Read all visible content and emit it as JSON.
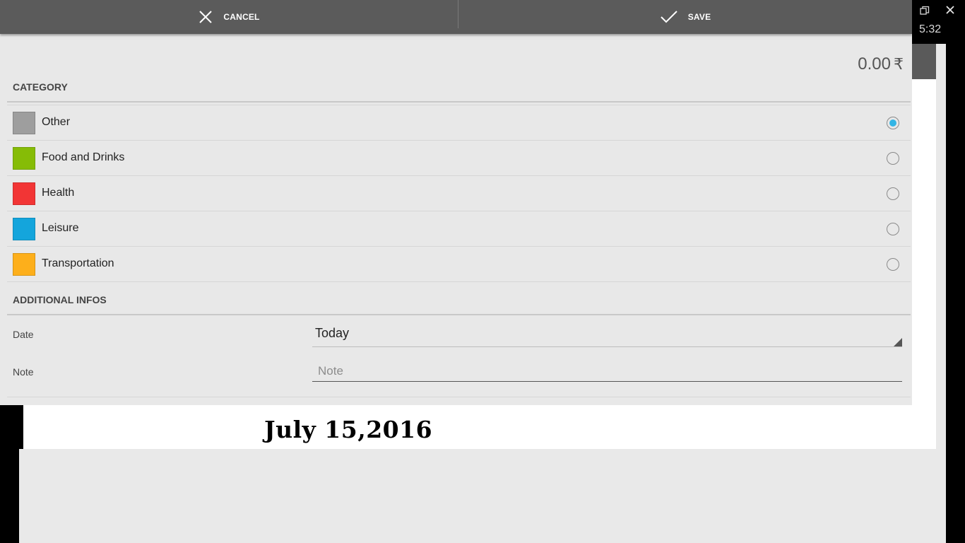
{
  "action_bar": {
    "cancel_label": "CANCEL",
    "cancel_icon": "close-icon",
    "save_label": "SAVE",
    "save_icon": "check-icon"
  },
  "amount": {
    "value": "0.00",
    "currency": "₹"
  },
  "category": {
    "header": "CATEGORY",
    "items": [
      {
        "label": "Other",
        "color": "#9e9e9e",
        "selected": true
      },
      {
        "label": "Food and Drinks",
        "color": "#86bc06",
        "selected": false
      },
      {
        "label": "Health",
        "color": "#f23535",
        "selected": false
      },
      {
        "label": "Leisure",
        "color": "#14a5dc",
        "selected": false
      },
      {
        "label": "Transportation",
        "color": "#fdaf1b",
        "selected": false
      }
    ]
  },
  "additional": {
    "header": "ADDITIONAL INFOS",
    "date_label": "Date",
    "date_value": "Today",
    "note_label": "Note",
    "note_placeholder": "Note",
    "note_value": ""
  },
  "system": {
    "clock": "5:32",
    "restore_icon": "restore-window-icon",
    "close_icon": "close-icon"
  },
  "caption": "July 15,2016",
  "colors": {
    "action_bar": "#5b5b5b",
    "panel_bg": "#e8e8e8",
    "radio_accent": "#33b5e5"
  }
}
